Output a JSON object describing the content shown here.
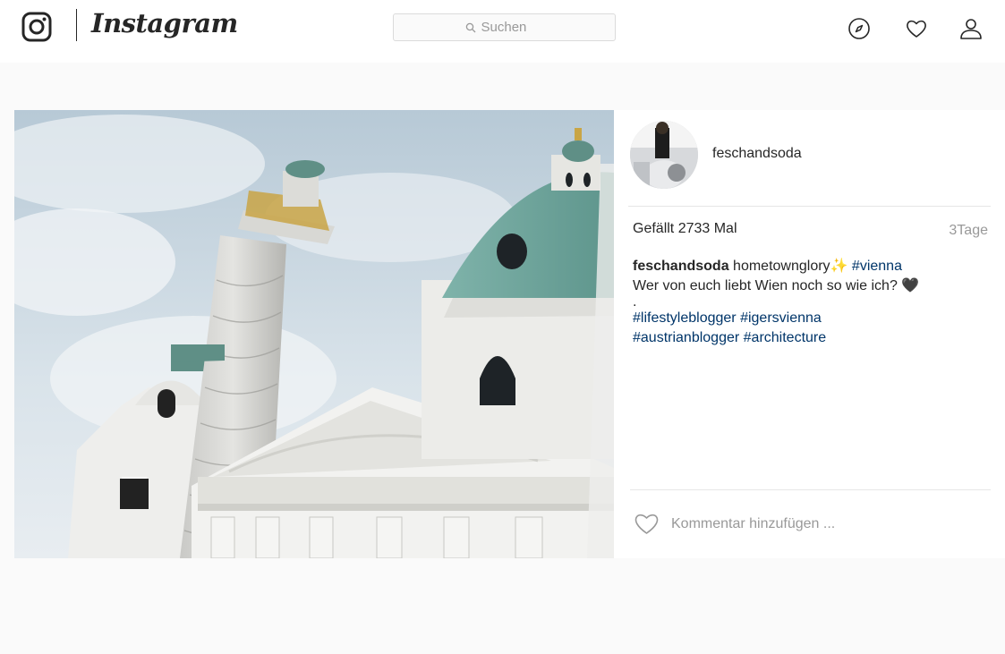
{
  "brand": {
    "wordmark": "Instagram",
    "logo_icon": "instagram-camera-icon"
  },
  "search": {
    "placeholder": "Suchen",
    "value": "",
    "icon": "search-icon"
  },
  "nav": {
    "icons": [
      "compass-icon",
      "heart-icon",
      "person-icon"
    ]
  },
  "post": {
    "username": "feschandsoda",
    "likes": "Gefällt 2733 Mal",
    "time": "3Tage",
    "caption": {
      "username": "feschandsoda",
      "text": "hometownglory",
      "emoji": "✨",
      "hashtag_1": "#vienna",
      "line2": "Wer von euch liebt Wien noch so wie ich?",
      "heart": "🖤",
      "dot": ".",
      "hashtag_2": "#lifestyleblogger",
      "hashtag_3": "#igersvienna",
      "hashtag_4": "#austrianblogger",
      "hashtag_5": "#architecture"
    },
    "comment": {
      "placeholder": "Kommentar hinzufügen ...",
      "value": ""
    }
  },
  "colors": {
    "background": "#fafafa",
    "text": "#262626",
    "muted": "#999999",
    "link": "#003569",
    "border": "#dbdbdb"
  }
}
